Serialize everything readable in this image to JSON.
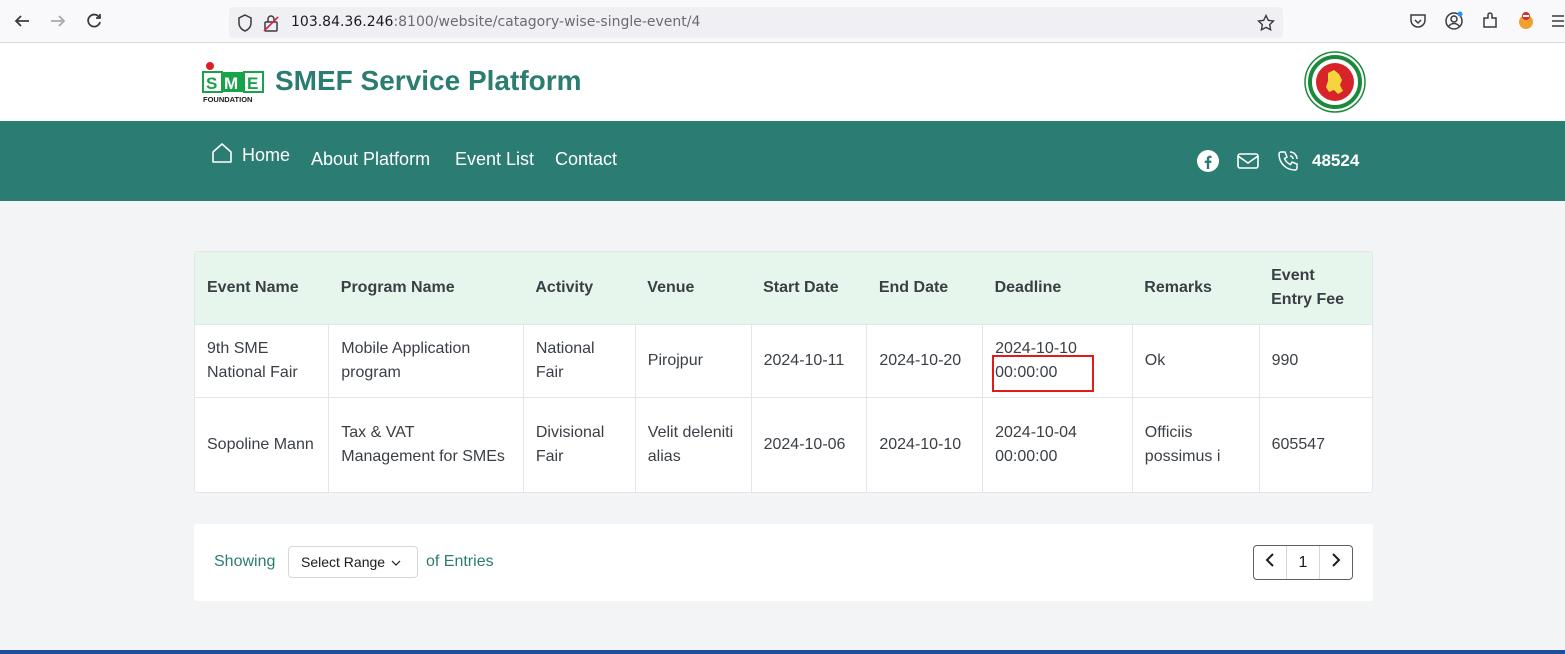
{
  "browser": {
    "url_host": "103.84.36.246",
    "url_rest": ":8100/website/catagory-wise-single-event/4"
  },
  "site": {
    "title": "SMEF Service Platform",
    "logo_text": "SME",
    "logo_sub": "FOUNDATION"
  },
  "nav": {
    "home": "Home",
    "about": "About Platform",
    "events": "Event List",
    "contact": "Contact",
    "phone": "48524"
  },
  "table": {
    "headers": [
      "Event Name",
      "Program Name",
      "Activity",
      "Venue",
      "Start Date",
      "End Date",
      "Deadline",
      "Remarks",
      "Event Entry Fee"
    ],
    "rows": [
      {
        "event_name": "9th SME National Fair",
        "program_name": "Mobile Application program",
        "activity": "National Fair",
        "venue": "Pirojpur",
        "start_date": "2024-10-11",
        "end_date": "2024-10-20",
        "deadline_date": "2024-10-10",
        "deadline_time": "00:00:00",
        "remarks": "Ok",
        "fee": "990"
      },
      {
        "event_name": "Sopoline Mann",
        "program_name": "Tax & VAT Management for SMEs",
        "activity": "Divisional Fair",
        "venue": "Velit deleniti alias",
        "start_date": "2024-10-06",
        "end_date": "2024-10-10",
        "deadline_date": "2024-10-04",
        "deadline_time": "00:00:00",
        "remarks": "Officiis possimus i",
        "fee": "605547"
      }
    ]
  },
  "footer": {
    "showing": "Showing",
    "range_placeholder": "Select Range",
    "of_entries": "of Entries",
    "current_page": "1"
  },
  "colors": {
    "brand_green": "#2b7c72",
    "header_row": "#e6f6ec",
    "highlight": "#e01b1b"
  }
}
